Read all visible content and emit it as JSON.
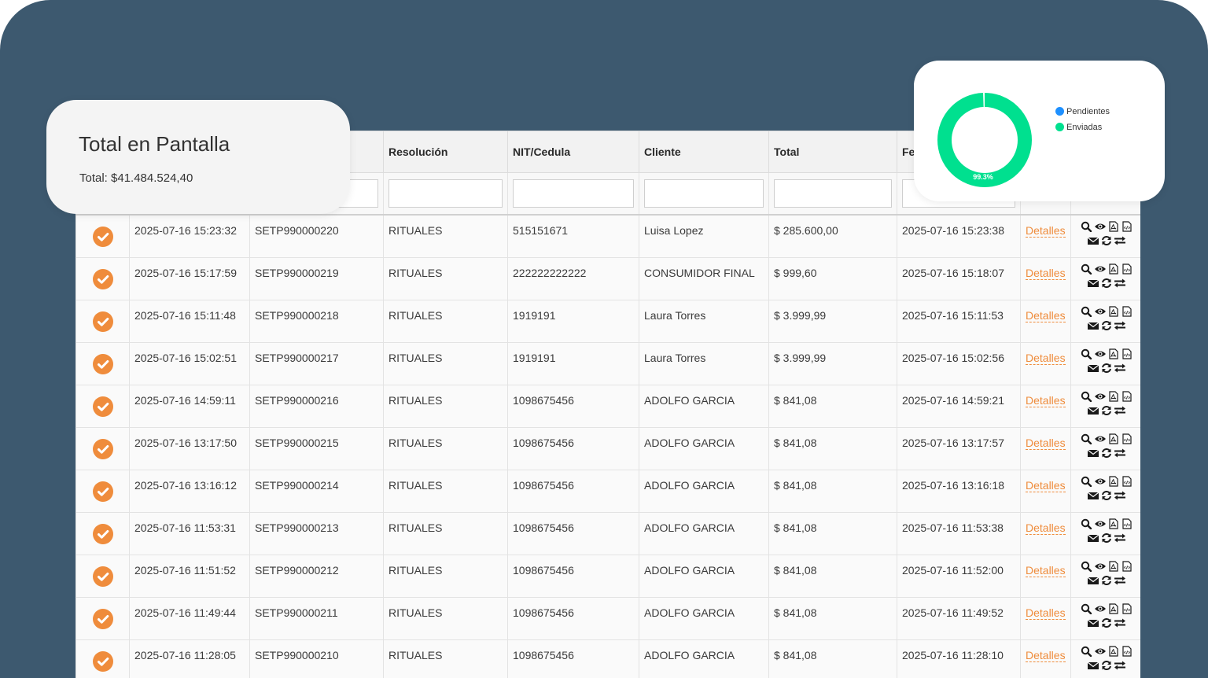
{
  "summary_card": {
    "title": "Total en Pantalla",
    "total": "Total: $41.484.524,40"
  },
  "table": {
    "columns": [
      "",
      "",
      "",
      "Resolución",
      "NIT/Cedula",
      "Cliente",
      "Total",
      "Fe",
      "",
      ""
    ],
    "rows": [
      {
        "date": "2025-07-16 15:23:32",
        "number": "SETP990000220",
        "resolution": "RITUALES",
        "nit": "515151671",
        "client": "Luisa Lopez",
        "total": "$ 285.600,00",
        "sent": "2025-07-16 15:23:38",
        "details": "Detalles"
      },
      {
        "date": "2025-07-16 15:17:59",
        "number": "SETP990000219",
        "resolution": "RITUALES",
        "nit": "222222222222",
        "client": "CONSUMIDOR FINAL",
        "total": "$ 999,60",
        "sent": "2025-07-16 15:18:07",
        "details": "Detalles"
      },
      {
        "date": "2025-07-16 15:11:48",
        "number": "SETP990000218",
        "resolution": "RITUALES",
        "nit": "1919191",
        "client": "Laura Torres",
        "total": "$ 3.999,99",
        "sent": "2025-07-16 15:11:53",
        "details": "Detalles"
      },
      {
        "date": "2025-07-16 15:02:51",
        "number": "SETP990000217",
        "resolution": "RITUALES",
        "nit": "1919191",
        "client": "Laura Torres",
        "total": "$ 3.999,99",
        "sent": "2025-07-16 15:02:56",
        "details": "Detalles"
      },
      {
        "date": "2025-07-16 14:59:11",
        "number": "SETP990000216",
        "resolution": "RITUALES",
        "nit": "1098675456",
        "client": "ADOLFO GARCIA",
        "total": "$ 841,08",
        "sent": "2025-07-16 14:59:21",
        "details": "Detalles"
      },
      {
        "date": "2025-07-16 13:17:50",
        "number": "SETP990000215",
        "resolution": "RITUALES",
        "nit": "1098675456",
        "client": "ADOLFO GARCIA",
        "total": "$ 841,08",
        "sent": "2025-07-16 13:17:57",
        "details": "Detalles"
      },
      {
        "date": "2025-07-16 13:16:12",
        "number": "SETP990000214",
        "resolution": "RITUALES",
        "nit": "1098675456",
        "client": "ADOLFO GARCIA",
        "total": "$ 841,08",
        "sent": "2025-07-16 13:16:18",
        "details": "Detalles"
      },
      {
        "date": "2025-07-16 11:53:31",
        "number": "SETP990000213",
        "resolution": "RITUALES",
        "nit": "1098675456",
        "client": "ADOLFO GARCIA",
        "total": "$ 841,08",
        "sent": "2025-07-16 11:53:38",
        "details": "Detalles"
      },
      {
        "date": "2025-07-16 11:51:52",
        "number": "SETP990000212",
        "resolution": "RITUALES",
        "nit": "1098675456",
        "client": "ADOLFO GARCIA",
        "total": "$ 841,08",
        "sent": "2025-07-16 11:52:00",
        "details": "Detalles"
      },
      {
        "date": "2025-07-16 11:49:44",
        "number": "SETP990000211",
        "resolution": "RITUALES",
        "nit": "1098675456",
        "client": "ADOLFO GARCIA",
        "total": "$ 841,08",
        "sent": "2025-07-16 11:49:52",
        "details": "Detalles"
      },
      {
        "date": "2025-07-16 11:28:05",
        "number": "SETP990000210",
        "resolution": "RITUALES",
        "nit": "1098675456",
        "client": "ADOLFO GARCIA",
        "total": "$ 841,08",
        "sent": "2025-07-16 11:28:10",
        "details": "Detalles"
      }
    ]
  },
  "donut": {
    "legend": [
      {
        "label": "Pendientes",
        "color": "#1e90ff"
      },
      {
        "label": "Enviadas",
        "color": "#00e08f"
      }
    ],
    "sent_fraction": 0.993,
    "label": "99.3%"
  },
  "colors": {
    "background": "#3d596f",
    "accent": "#ef8c3c",
    "donut_sent": "#00e08f",
    "donut_pending": "#1e90ff"
  },
  "icons": [
    "check-circle-icon",
    "search-icon",
    "eye-icon",
    "pdf-icon",
    "xml-icon",
    "envelope-icon",
    "refresh-icon",
    "exchange-icon"
  ]
}
